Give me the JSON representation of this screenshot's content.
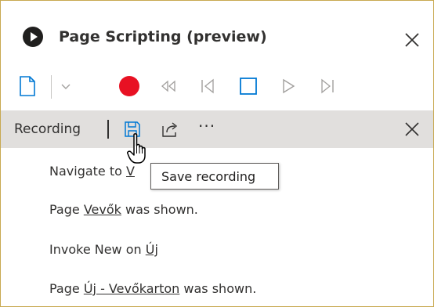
{
  "window": {
    "title": "Page Scripting (preview)"
  },
  "toolbar": {
    "buttons": [
      "new-file",
      "dropdown",
      "record",
      "rewind",
      "step-back",
      "stop",
      "play",
      "step-forward"
    ]
  },
  "recording_bar": {
    "label": "Recording",
    "buttons": [
      "save",
      "share",
      "more"
    ],
    "more_label": "···"
  },
  "steps": [
    {
      "prefix": "Navigate to ",
      "link": "V",
      "suffix": ""
    },
    {
      "prefix": "Page ",
      "link": "Vevők",
      "suffix": " was shown."
    },
    {
      "prefix": "Invoke New on ",
      "link": "Új",
      "suffix": ""
    },
    {
      "prefix": "Page ",
      "link": "Új - Vevőkarton",
      "suffix": " was shown."
    }
  ],
  "tooltip": {
    "text": "Save recording"
  },
  "colors": {
    "accent": "#0078d4",
    "record": "#e81123",
    "disabled": "#a19f9d",
    "border": "#c8a951"
  }
}
